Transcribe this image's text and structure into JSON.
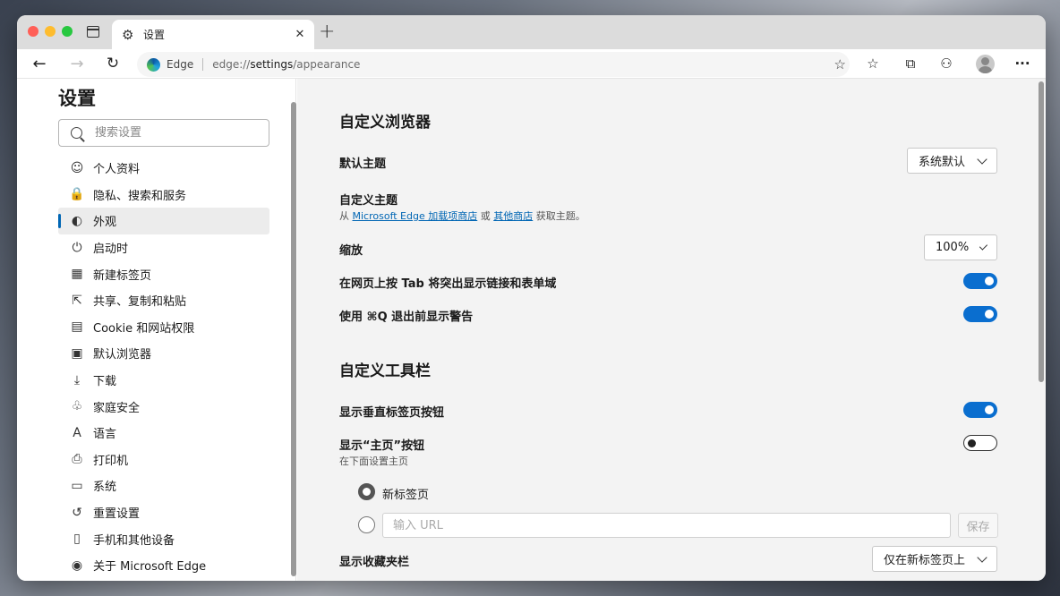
{
  "tab": {
    "title": "设置",
    "close_glyph": "✕",
    "new_tab_glyph": "+"
  },
  "address": {
    "brand": "Edge",
    "url_prefix": "edge://",
    "url_host": "settings",
    "url_path": "/appearance"
  },
  "icons": {
    "back": "←",
    "forward": "→",
    "refresh": "↻",
    "favorite_add": "☆",
    "favorites": "☆",
    "collections": "⧉",
    "extensions": "⚇",
    "more": "···"
  },
  "sidebar": {
    "title": "设置",
    "search_placeholder": "搜索设置",
    "items": [
      {
        "label": "个人资料",
        "icon": "☺",
        "active": false
      },
      {
        "label": "隐私、搜索和服务",
        "icon": "🔒",
        "active": false
      },
      {
        "label": "外观",
        "icon": "◐",
        "active": true
      },
      {
        "label": "启动时",
        "icon": "⏻",
        "active": false
      },
      {
        "label": "新建标签页",
        "icon": "▦",
        "active": false
      },
      {
        "label": "共享、复制和粘贴",
        "icon": "⇱",
        "active": false
      },
      {
        "label": "Cookie 和网站权限",
        "icon": "▤",
        "active": false
      },
      {
        "label": "默认浏览器",
        "icon": "▣",
        "active": false
      },
      {
        "label": "下载",
        "icon": "⤓",
        "active": false
      },
      {
        "label": "家庭安全",
        "icon": "♧",
        "active": false
      },
      {
        "label": "语言",
        "icon": "A",
        "active": false
      },
      {
        "label": "打印机",
        "icon": "⎙",
        "active": false
      },
      {
        "label": "系统",
        "icon": "▭",
        "active": false
      },
      {
        "label": "重置设置",
        "icon": "↺",
        "active": false
      },
      {
        "label": "手机和其他设备",
        "icon": "▯",
        "active": false
      },
      {
        "label": "关于 Microsoft Edge",
        "icon": "◉",
        "active": false
      }
    ]
  },
  "main": {
    "browser_section_title": "自定义浏览器",
    "default_theme_label": "默认主题",
    "default_theme_value": "系统默认",
    "custom_theme_label": "自定义主题",
    "custom_theme_sub_prefix": "从",
    "custom_theme_link1": "Microsoft Edge 加载项商店",
    "custom_theme_sub_or": "或",
    "custom_theme_link2": "其他商店",
    "custom_theme_sub_suffix": "获取主题。",
    "zoom_label": "缩放",
    "zoom_value": "100%",
    "tab_highlight_label": "在网页上按 Tab 将突出显示链接和表单域",
    "tab_highlight_on": true,
    "quit_warning_label": "使用 ⌘Q 退出前显示警告",
    "quit_warning_on": true,
    "toolbar_section_title": "自定义工具栏",
    "vertical_tabs_label": "显示垂直标签页按钮",
    "vertical_tabs_on": true,
    "home_button_label": "显示“主页”按钮",
    "home_button_on": false,
    "home_button_sub": "在下面设置主页",
    "radio_newtab_label": "新标签页",
    "url_placeholder": "输入 URL",
    "save_label": "保存",
    "favorites_bar_label": "显示收藏夹栏",
    "favorites_bar_value": "仅在新标签页上"
  },
  "colors": {
    "accent": "#0a6ecf",
    "link": "#0066b4"
  }
}
